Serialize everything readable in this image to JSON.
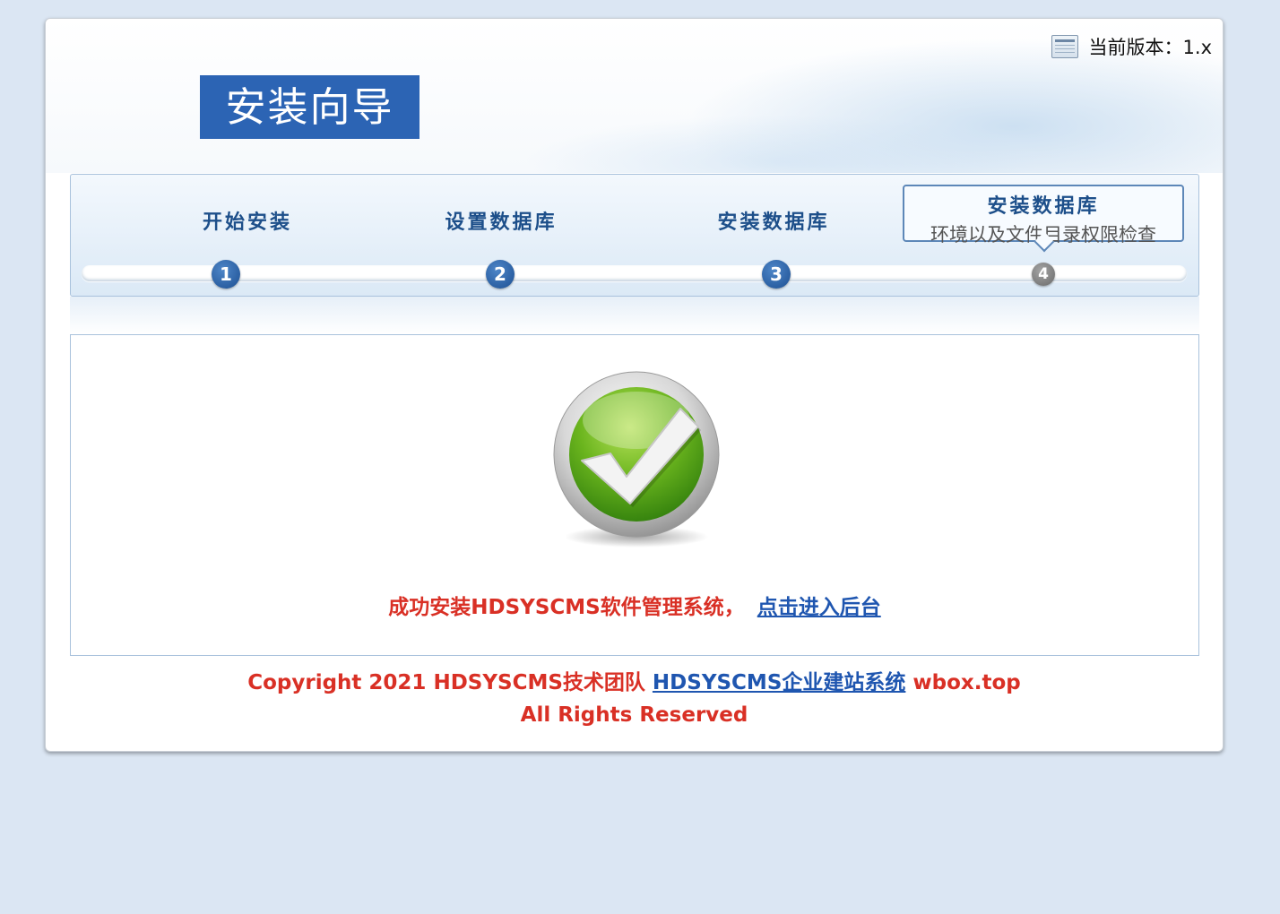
{
  "header": {
    "logo_text": "安装向导",
    "version_label": "当前版本：1.x"
  },
  "steps": [
    {
      "label": "开始安装",
      "number": "1"
    },
    {
      "label": "设置数据库",
      "number": "2"
    },
    {
      "label": "安装数据库",
      "number": "3"
    },
    {
      "label": "安装数据库",
      "sublabel": "环境以及文件目录权限检查",
      "number": "4",
      "active": true
    }
  ],
  "main": {
    "icon": "success-check-icon",
    "message": "成功安装HDSYSCMS软件管理系统，",
    "admin_link": "点击进入后台"
  },
  "footer": {
    "copyright_prefix": "Copyright 2021 HDSYSCMS技术团队",
    "site_link": "HDSYSCMS企业建站系统",
    "domain": "wbox.top",
    "rights": "All Rights Reserved"
  },
  "colors": {
    "background": "#dbe6f3",
    "brand_blue": "#2c64b4",
    "step_text": "#1d4f8a",
    "success_red": "#d93025",
    "link_blue": "#1f56b0"
  }
}
